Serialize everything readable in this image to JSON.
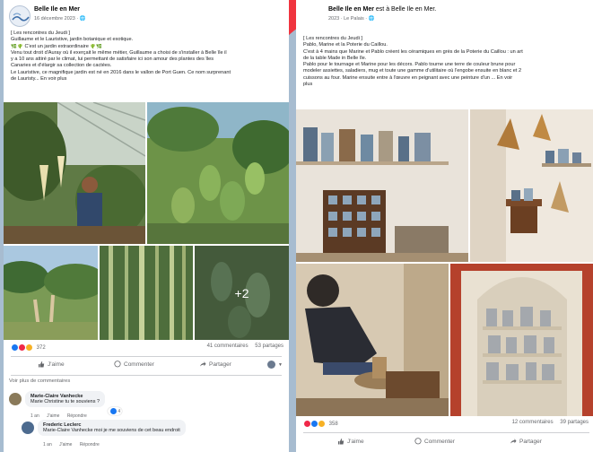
{
  "left_post": {
    "page_name": "Belle Ile en Mer",
    "date": "16 décembre 2023 · ",
    "text_lines": [
      "[ Les rencontres du Jeudi ]",
      "Guillaume et le Lauristive, jardin botanique et exotique.",
      "🌿🌵 C'est un jardin extraordinaire 🌵🌿",
      "Venu tout droit d'Auray où il exerçait le même métier, Guillaume a choisi de s'installer à Belle île il",
      "y a 10 ans attiré par le climat, lui permettant de satisfaire ici son amour des plantes des îles",
      "Canaries et d'élargir sa collection de cactées.",
      "Le Lauristive, ce magnifique jardin est né en 2016 dans le vallon de Port Guen. Ce nom surprenant",
      "de Lauristy... En voir plus"
    ],
    "more_photos": "+2",
    "reaction_count": "372",
    "comments_count": "41 commentaires",
    "shares_count": "53 partages",
    "like_label": "J'aime",
    "comment_label": "Commenter",
    "share_label": "Partager",
    "view_more_comments": "Voir plus de commentaires",
    "comments": [
      {
        "author": "Marie-Claire Vanhecke",
        "text": "Marie Christine tu te souviens ?",
        "time": "1 an",
        "like": "J'aime",
        "reply": "Répondre",
        "reactions": "4"
      },
      {
        "author": "Frederic Leclerc",
        "text": "Marie-Claire Vanhecke moi je me souviens de cet beau endroit",
        "time": "1 an",
        "like": "J'aime",
        "reply": "Répondre"
      }
    ]
  },
  "right_post": {
    "author_line": "Belle Ile en Mer est à Belle Ile en Mer.",
    "page_name": "Belle Ile en Mer",
    "author_suffix": " est à Belle Ile en Mer.",
    "meta": "2023 · Le Palais · 🌐",
    "text_lines": [
      "[ Les rencontres du Jeudi ]",
      "Pablo, Marine et la Poterie du Caillou.",
      "C'est à 4 mains que Marine et Pablo créent les céramiques en grès de la Poterie du Caillou : un art",
      "de la table Made in Belle île.",
      "Pablo pour le tournage et Marine pour les décors. Pablo tourne une terre de couleur brune pour",
      "modeler assiettes, saladiers, mug et toute une gamme d'utilitaire où l'engobe ensuite en blanc et 2",
      "cuissons au four. Marine ensuite entre à l'œuvre en peignant avec une peinture d'un ... En voir",
      "plus"
    ],
    "reaction_count": "358",
    "comments_count": "12 commentaires",
    "shares_count": "39 partages",
    "like_label": "J'aime",
    "comment_label": "Commenter",
    "share_label": "Partager"
  },
  "colors": {
    "facebook_blue": "#1877f2",
    "love_red": "#f02849",
    "heart_overlay": "#f0343f",
    "backdrop": "#a7bcd0"
  }
}
